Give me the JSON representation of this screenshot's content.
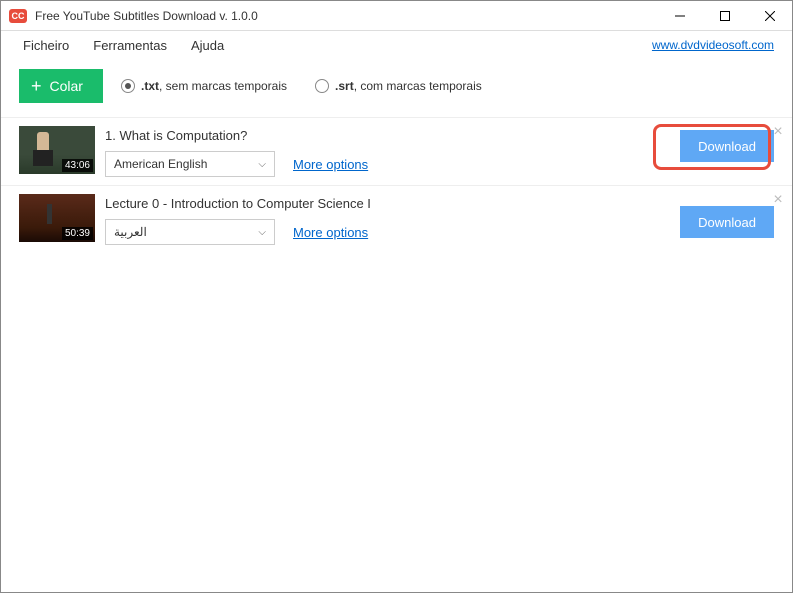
{
  "window": {
    "icon_text": "CC",
    "title": "Free YouTube Subtitles Download v. 1.0.0"
  },
  "menu": {
    "file": "Ficheiro",
    "tools": "Ferramentas",
    "help": "Ajuda",
    "site_link": "www.dvdvideosoft.com"
  },
  "toolbar": {
    "paste_label": "Colar",
    "format_txt_bold": ".txt",
    "format_txt_rest": ", sem marcas temporais",
    "format_srt_bold": ".srt",
    "format_srt_rest": ", com marcas temporais"
  },
  "items": [
    {
      "title": "1. What is Computation?",
      "language": "American English",
      "duration": "43:06",
      "more": "More options",
      "download": "Download"
    },
    {
      "title": "Lecture 0 - Introduction to Computer Science I",
      "language": "العربية",
      "duration": "50:39",
      "more": "More options",
      "download": "Download"
    }
  ]
}
